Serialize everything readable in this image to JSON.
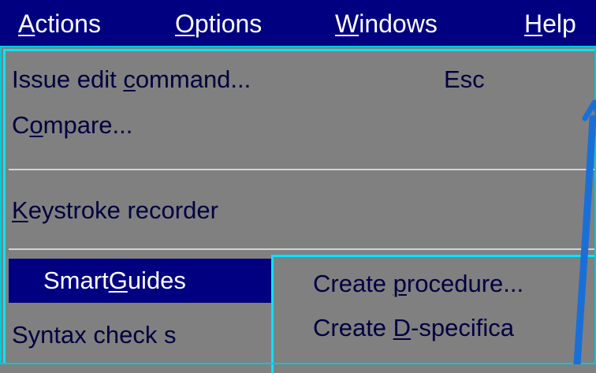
{
  "menubar": {
    "items": [
      {
        "label_pre": "",
        "label_mnemonic": "A",
        "label_post": "ctions",
        "active": true
      },
      {
        "label_pre": "",
        "label_mnemonic": "O",
        "label_post": "ptions",
        "active": false
      },
      {
        "label_pre": "",
        "label_mnemonic": "W",
        "label_post": "indows",
        "active": false
      },
      {
        "label_pre": "",
        "label_mnemonic": "H",
        "label_post": "elp",
        "active": false
      }
    ]
  },
  "actions_menu": {
    "items": [
      {
        "label_pre": "Issue edit ",
        "label_mnemonic": "c",
        "label_post": "ommand...",
        "shortcut": "Esc"
      },
      {
        "label_pre": "C",
        "label_mnemonic": "o",
        "label_post": "mpare..."
      },
      {
        "label_pre": "",
        "label_mnemonic": "K",
        "label_post": "eystroke recorder"
      },
      {
        "label_pre": "Smart",
        "label_mnemonic": "G",
        "label_post": "uides",
        "highlighted": true
      },
      {
        "label_pre": "Syntax check s",
        "label_mnemonic": "",
        "label_post": ""
      }
    ]
  },
  "smartguides_submenu": {
    "items": [
      {
        "label_pre": "Create ",
        "label_mnemonic": "p",
        "label_post": "rocedure..."
      },
      {
        "label_pre": "Create ",
        "label_mnemonic": "D",
        "label_post": "-specifica"
      }
    ]
  },
  "colors": {
    "menubar_bg": "#000080",
    "menu_bg": "#808080",
    "highlight_bg": "#000080",
    "border_accent": "#00e5ff",
    "annotation_arrow": "#1a6fd6"
  },
  "icons": {
    "annotation": "arrow-up-icon"
  }
}
